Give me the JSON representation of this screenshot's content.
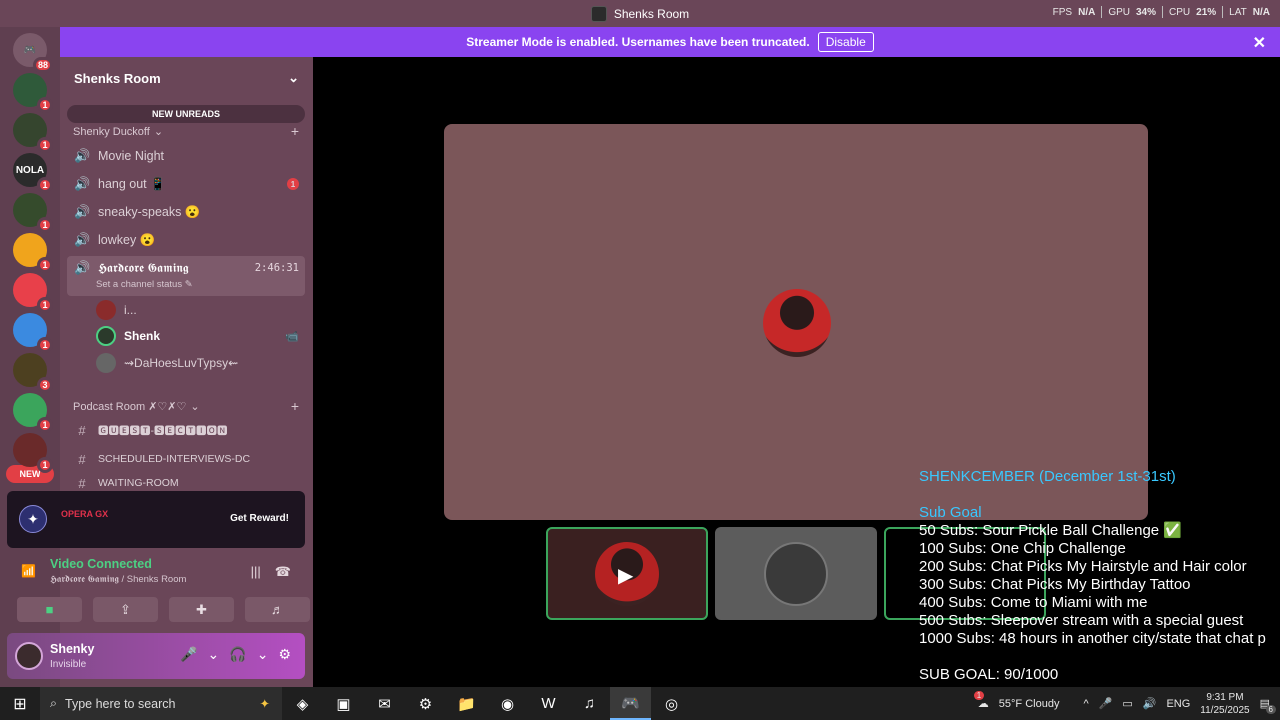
{
  "window": {
    "title": "Shenks Room"
  },
  "perf": {
    "fps_label": "FPS",
    "fps": "N/A",
    "gpu_label": "GPU",
    "gpu": "34%",
    "cpu_label": "CPU",
    "cpu": "21%",
    "lat_label": "LAT",
    "lat": "N/A"
  },
  "banner": {
    "text": "Streamer Mode is enabled. Usernames have been truncated.",
    "button": "Disable"
  },
  "rail": {
    "home_badge": "88",
    "servers": [
      {
        "badge": "1",
        "color": "#2f5a3a"
      },
      {
        "badge": "1",
        "color": "#35452e"
      },
      {
        "badge": "1",
        "color": "#2b2b2b",
        "label": "NOLA"
      },
      {
        "badge": "1",
        "color": "#354b2c"
      },
      {
        "badge": "1",
        "color": "#f0a41c"
      },
      {
        "badge": "1",
        "color": "#e8404a"
      },
      {
        "badge": "1",
        "color": "#3b8ae0"
      },
      {
        "badge": "3",
        "color": "#4d4020"
      },
      {
        "badge": "1",
        "color": "#3ba55c"
      },
      {
        "badge": "1",
        "color": "#6a2a2a"
      }
    ],
    "new_label": "NEW"
  },
  "sidebar": {
    "server_name": "Shenks Room",
    "new_unreads": "NEW UNREADS",
    "category1": "Shenky Duckoff",
    "channels": [
      {
        "name": "Movie Night"
      },
      {
        "name": "hang out 📱",
        "badge": "1"
      },
      {
        "name": "sneaky-speaks 😮"
      },
      {
        "name": "lowkey 😮"
      }
    ],
    "active": {
      "name": "𝕳𝖆𝖗𝖉𝖈𝖔𝖗𝖊 𝕲𝖆𝖒𝖎𝖓𝖌",
      "timer": "2:46:31",
      "status": "Set a channel status"
    },
    "voice_users": [
      "i...",
      "Shenk",
      "⇝DaHoesLuvTypsy⇜"
    ],
    "category2": "Podcast Room ✗♡✗♡",
    "text_channels": [
      "🅶🆄🅴🆂🆃-🆂🅴🅲🆃🅸🅾🅽",
      "scheduled-interviews-dc",
      "waiting-room"
    ]
  },
  "promo": {
    "brand": "OPERA GX",
    "cta": "Get Reward!"
  },
  "voice": {
    "status": "Video Connected",
    "location": "𝕳𝖆𝖗𝖉𝖈𝖔𝖗𝖊 𝕲𝖆𝖒𝖎𝖓𝖌 / Shenks Room"
  },
  "user": {
    "name": "Shenky",
    "status": "Invisible"
  },
  "overlay": {
    "title": "SHENKCEMBER (December 1st-31st)",
    "goal_header": "Sub Goal",
    "goals": [
      " 50 Subs: Sour Pickle Ball Challenge ✅",
      "100 Subs: One Chip Challenge",
      "200 Subs: Chat Picks My Hairstyle and Hair color",
      "300 Subs: Chat Picks My Birthday Tattoo",
      "400 Subs: Come to Miami with me",
      "500 Subs: Sleepover stream with a special guest",
      "1000 Subs: 48 hours in another city/state that chat p"
    ],
    "sub_goal": "SUB GOAL: 90/1000"
  },
  "taskbar": {
    "search_placeholder": "Type here to search",
    "weather": "55°F  Cloudy",
    "weather_badge": "1",
    "lang": "ENG",
    "time": "9:31 PM",
    "date": "11/25/2025",
    "notif": "6"
  }
}
